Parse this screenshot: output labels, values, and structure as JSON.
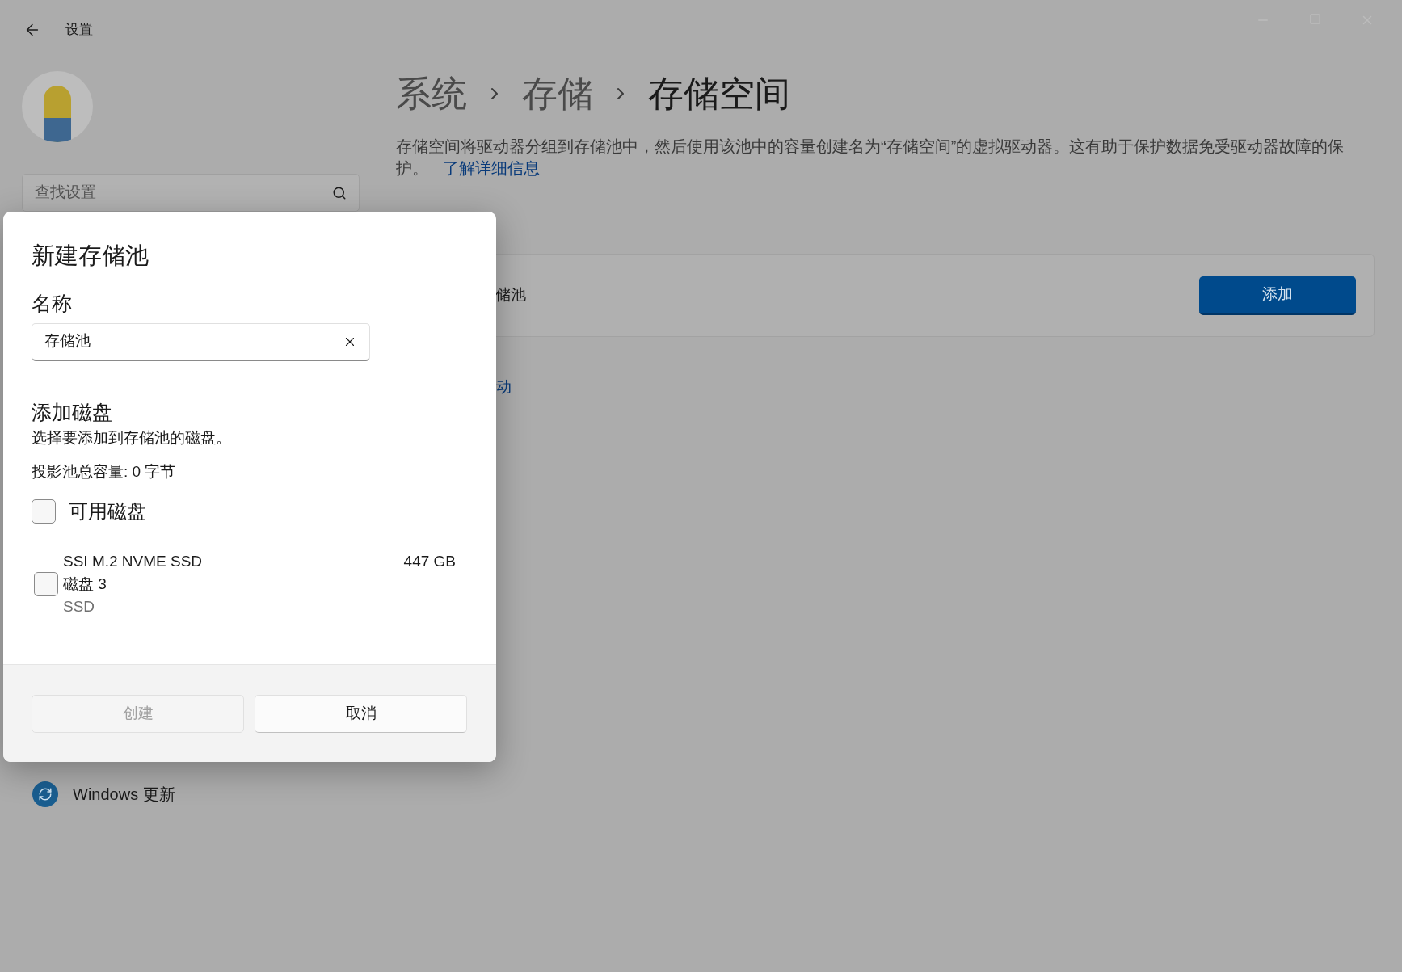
{
  "window": {
    "title": "设置"
  },
  "sidebar": {
    "search": {
      "placeholder": "查找设置"
    },
    "items": [
      {
        "label": "Windows 更新"
      }
    ]
  },
  "breadcrumb": [
    {
      "label": "系统",
      "current": false
    },
    {
      "label": "存储",
      "current": false
    },
    {
      "label": "存储空间",
      "current": true
    }
  ],
  "description": {
    "text": "存储空间将驱动器分组到存储池中，然后使用该池中的容量创建名为“存储空间”的虚拟驱动器。这有助于保护数据免受驱动器故障的保护。",
    "link": "了解详细信息"
  },
  "card": {
    "label": "储池",
    "button": "添加"
  },
  "partial_link": "动",
  "dialog": {
    "title": "新建存储池",
    "name_label": "名称",
    "name_value": "存储池",
    "section_title": "添加磁盘",
    "section_desc": "选择要添加到存储池的磁盘。",
    "capacity": "投影池总容量: 0 字节",
    "select_all": {
      "label": "可用磁盘",
      "checked": false
    },
    "disks": [
      {
        "name": "SSI M.2 NVME SSD",
        "disk": "磁盘 3",
        "type": "SSD",
        "size": "447 GB",
        "checked": false
      }
    ],
    "buttons": [
      {
        "label": "创建",
        "disabled": true
      },
      {
        "label": "取消",
        "disabled": false
      }
    ]
  }
}
